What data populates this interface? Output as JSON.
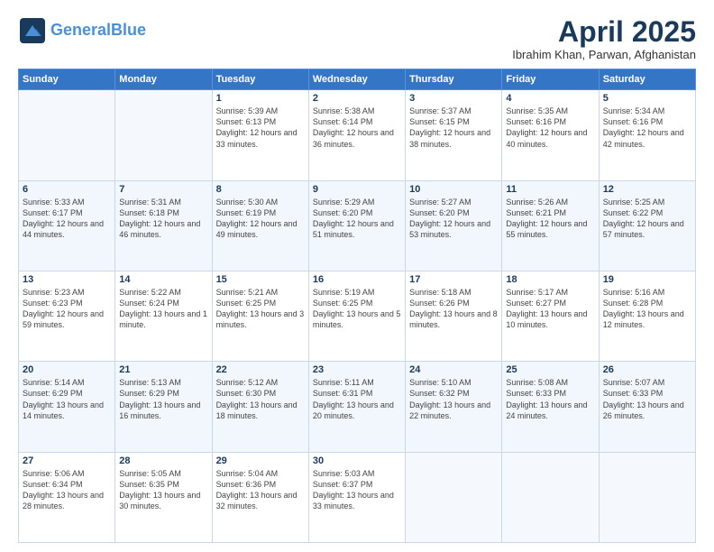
{
  "logo": {
    "general": "General",
    "blue": "Blue",
    "tagline": ""
  },
  "title": "April 2025",
  "subtitle": "Ibrahim Khan, Parwan, Afghanistan",
  "days_header": [
    "Sunday",
    "Monday",
    "Tuesday",
    "Wednesday",
    "Thursday",
    "Friday",
    "Saturday"
  ],
  "weeks": [
    [
      {
        "num": "",
        "sunrise": "",
        "sunset": "",
        "daylight": ""
      },
      {
        "num": "",
        "sunrise": "",
        "sunset": "",
        "daylight": ""
      },
      {
        "num": "1",
        "sunrise": "Sunrise: 5:39 AM",
        "sunset": "Sunset: 6:13 PM",
        "daylight": "Daylight: 12 hours and 33 minutes."
      },
      {
        "num": "2",
        "sunrise": "Sunrise: 5:38 AM",
        "sunset": "Sunset: 6:14 PM",
        "daylight": "Daylight: 12 hours and 36 minutes."
      },
      {
        "num": "3",
        "sunrise": "Sunrise: 5:37 AM",
        "sunset": "Sunset: 6:15 PM",
        "daylight": "Daylight: 12 hours and 38 minutes."
      },
      {
        "num": "4",
        "sunrise": "Sunrise: 5:35 AM",
        "sunset": "Sunset: 6:16 PM",
        "daylight": "Daylight: 12 hours and 40 minutes."
      },
      {
        "num": "5",
        "sunrise": "Sunrise: 5:34 AM",
        "sunset": "Sunset: 6:16 PM",
        "daylight": "Daylight: 12 hours and 42 minutes."
      }
    ],
    [
      {
        "num": "6",
        "sunrise": "Sunrise: 5:33 AM",
        "sunset": "Sunset: 6:17 PM",
        "daylight": "Daylight: 12 hours and 44 minutes."
      },
      {
        "num": "7",
        "sunrise": "Sunrise: 5:31 AM",
        "sunset": "Sunset: 6:18 PM",
        "daylight": "Daylight: 12 hours and 46 minutes."
      },
      {
        "num": "8",
        "sunrise": "Sunrise: 5:30 AM",
        "sunset": "Sunset: 6:19 PM",
        "daylight": "Daylight: 12 hours and 49 minutes."
      },
      {
        "num": "9",
        "sunrise": "Sunrise: 5:29 AM",
        "sunset": "Sunset: 6:20 PM",
        "daylight": "Daylight: 12 hours and 51 minutes."
      },
      {
        "num": "10",
        "sunrise": "Sunrise: 5:27 AM",
        "sunset": "Sunset: 6:20 PM",
        "daylight": "Daylight: 12 hours and 53 minutes."
      },
      {
        "num": "11",
        "sunrise": "Sunrise: 5:26 AM",
        "sunset": "Sunset: 6:21 PM",
        "daylight": "Daylight: 12 hours and 55 minutes."
      },
      {
        "num": "12",
        "sunrise": "Sunrise: 5:25 AM",
        "sunset": "Sunset: 6:22 PM",
        "daylight": "Daylight: 12 hours and 57 minutes."
      }
    ],
    [
      {
        "num": "13",
        "sunrise": "Sunrise: 5:23 AM",
        "sunset": "Sunset: 6:23 PM",
        "daylight": "Daylight: 12 hours and 59 minutes."
      },
      {
        "num": "14",
        "sunrise": "Sunrise: 5:22 AM",
        "sunset": "Sunset: 6:24 PM",
        "daylight": "Daylight: 13 hours and 1 minute."
      },
      {
        "num": "15",
        "sunrise": "Sunrise: 5:21 AM",
        "sunset": "Sunset: 6:25 PM",
        "daylight": "Daylight: 13 hours and 3 minutes."
      },
      {
        "num": "16",
        "sunrise": "Sunrise: 5:19 AM",
        "sunset": "Sunset: 6:25 PM",
        "daylight": "Daylight: 13 hours and 5 minutes."
      },
      {
        "num": "17",
        "sunrise": "Sunrise: 5:18 AM",
        "sunset": "Sunset: 6:26 PM",
        "daylight": "Daylight: 13 hours and 8 minutes."
      },
      {
        "num": "18",
        "sunrise": "Sunrise: 5:17 AM",
        "sunset": "Sunset: 6:27 PM",
        "daylight": "Daylight: 13 hours and 10 minutes."
      },
      {
        "num": "19",
        "sunrise": "Sunrise: 5:16 AM",
        "sunset": "Sunset: 6:28 PM",
        "daylight": "Daylight: 13 hours and 12 minutes."
      }
    ],
    [
      {
        "num": "20",
        "sunrise": "Sunrise: 5:14 AM",
        "sunset": "Sunset: 6:29 PM",
        "daylight": "Daylight: 13 hours and 14 minutes."
      },
      {
        "num": "21",
        "sunrise": "Sunrise: 5:13 AM",
        "sunset": "Sunset: 6:29 PM",
        "daylight": "Daylight: 13 hours and 16 minutes."
      },
      {
        "num": "22",
        "sunrise": "Sunrise: 5:12 AM",
        "sunset": "Sunset: 6:30 PM",
        "daylight": "Daylight: 13 hours and 18 minutes."
      },
      {
        "num": "23",
        "sunrise": "Sunrise: 5:11 AM",
        "sunset": "Sunset: 6:31 PM",
        "daylight": "Daylight: 13 hours and 20 minutes."
      },
      {
        "num": "24",
        "sunrise": "Sunrise: 5:10 AM",
        "sunset": "Sunset: 6:32 PM",
        "daylight": "Daylight: 13 hours and 22 minutes."
      },
      {
        "num": "25",
        "sunrise": "Sunrise: 5:08 AM",
        "sunset": "Sunset: 6:33 PM",
        "daylight": "Daylight: 13 hours and 24 minutes."
      },
      {
        "num": "26",
        "sunrise": "Sunrise: 5:07 AM",
        "sunset": "Sunset: 6:33 PM",
        "daylight": "Daylight: 13 hours and 26 minutes."
      }
    ],
    [
      {
        "num": "27",
        "sunrise": "Sunrise: 5:06 AM",
        "sunset": "Sunset: 6:34 PM",
        "daylight": "Daylight: 13 hours and 28 minutes."
      },
      {
        "num": "28",
        "sunrise": "Sunrise: 5:05 AM",
        "sunset": "Sunset: 6:35 PM",
        "daylight": "Daylight: 13 hours and 30 minutes."
      },
      {
        "num": "29",
        "sunrise": "Sunrise: 5:04 AM",
        "sunset": "Sunset: 6:36 PM",
        "daylight": "Daylight: 13 hours and 32 minutes."
      },
      {
        "num": "30",
        "sunrise": "Sunrise: 5:03 AM",
        "sunset": "Sunset: 6:37 PM",
        "daylight": "Daylight: 13 hours and 33 minutes."
      },
      {
        "num": "",
        "sunrise": "",
        "sunset": "",
        "daylight": ""
      },
      {
        "num": "",
        "sunrise": "",
        "sunset": "",
        "daylight": ""
      },
      {
        "num": "",
        "sunrise": "",
        "sunset": "",
        "daylight": ""
      }
    ]
  ]
}
